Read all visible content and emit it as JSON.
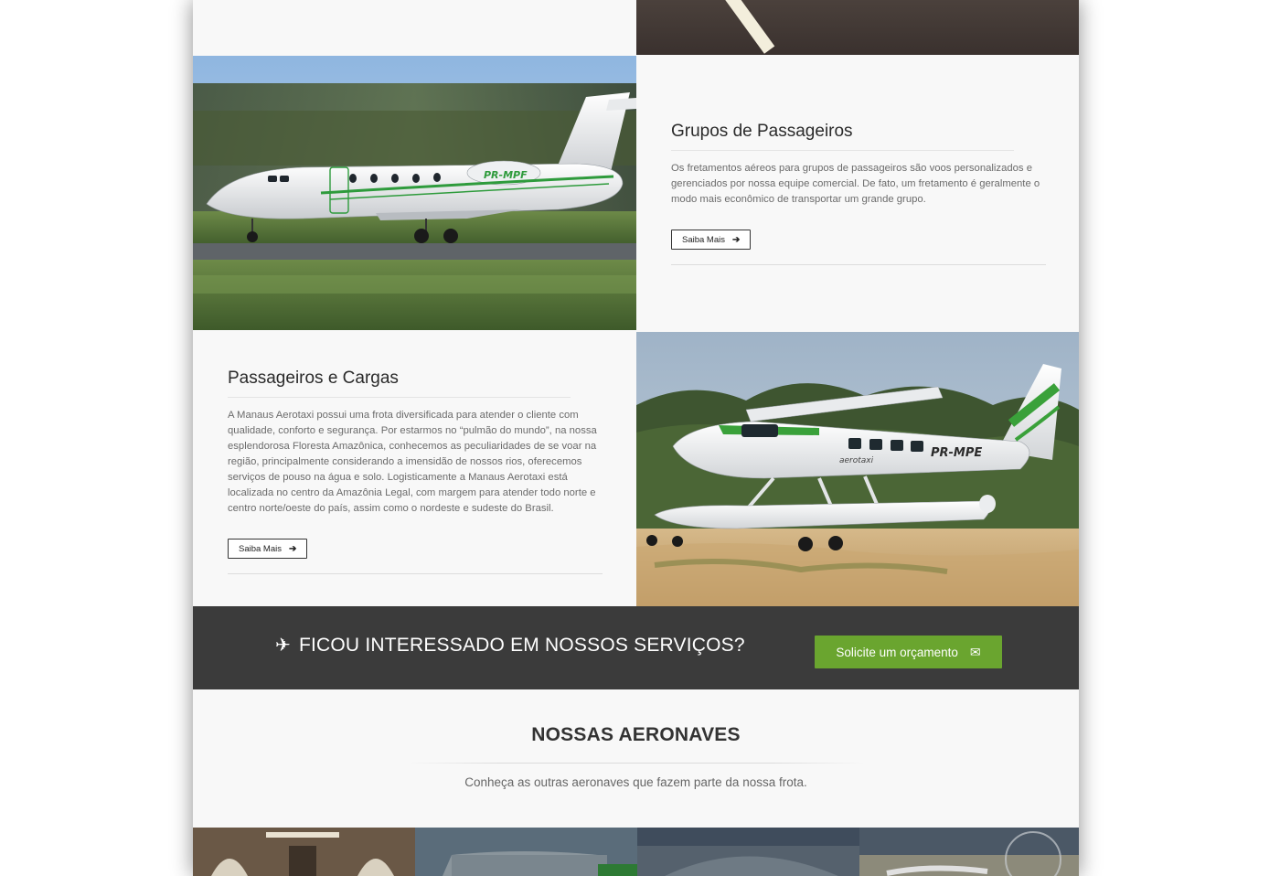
{
  "features": [
    {
      "title": "Grupos de Passageiros",
      "body": "Os fretamentos aéreos para grupos de passageiros são voos personalizados e gerenciados por nossa equipe comercial. De fato, um fretamento é geralmente o modo mais econômico de transportar um grande grupo.",
      "button_label": "Saiba Mais",
      "aircraft_registration": "PR-MPF"
    },
    {
      "title": "Passageiros e Cargas",
      "body": "A Manaus Aerotaxi possui uma frota diversificada para atender o cliente com qualidade, conforto e segurança. Por estarmos no “pulmão do mundo”, na nossa esplendorosa Floresta Amazônica, conhecemos as peculiaridades de se voar na região, principalmente considerando a imensidão de nossos rios, oferecemos serviços de pouso na água e solo. Logisticamente a Manaus Aerotaxi está localizada no centro da Amazônia Legal, com margem para atender todo norte e centro norte/oeste do país, assim como o nordeste e sudeste do Brasil.",
      "button_label": "Saiba Mais",
      "aircraft_registration": "PR-MPE",
      "aircraft_brand": "aerotaxi"
    }
  ],
  "cta": {
    "title": "FICOU INTERESSADO EM NOSSOS SERVIÇOS?",
    "button_label": "Solicite um orçamento",
    "icon": "plane-icon",
    "button_icon": "envelope-icon",
    "bg_color": "#3b3b3b",
    "button_color": "#6aa52f"
  },
  "fleet": {
    "title_light": "NOSSAS ",
    "title_bold": "AERONAVES",
    "subtitle": "Conheça as outras aeronaves que fazem parte da nossa frota."
  }
}
